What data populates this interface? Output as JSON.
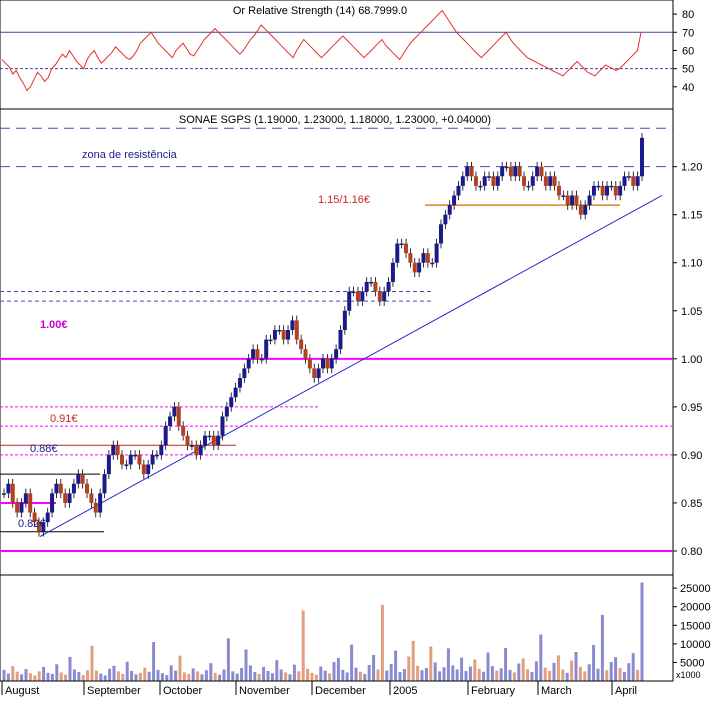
{
  "colors": {
    "background": "#ffffff",
    "frame": "#000000",
    "rsi_line": "#e8302a",
    "candle_up": "#1a1a8c",
    "candle_down": "#b3401f",
    "trendline": "#2a2ad0",
    "magenta_line": "#ff00ff",
    "resistance_dash": "#4a4ab0",
    "support_orange": "#e08020",
    "volume_up": "#8a8ad0",
    "volume_down": "#e0a080",
    "annotation_red": "#cc2020",
    "annotation_blue": "#1a1a8c",
    "annotation_magenta": "#cc00cc"
  },
  "rsi_panel": {
    "header": "Or Relative Strength (14) 68.7999.0",
    "ylim": [
      30,
      85
    ],
    "ticks": [
      "80",
      "70",
      "60",
      "50",
      "40"
    ],
    "overbought": 70,
    "midline": 50,
    "values": [
      55,
      53,
      51,
      47,
      49,
      45,
      42,
      38,
      40,
      44,
      48,
      46,
      43,
      45,
      50,
      52,
      55,
      58,
      56,
      60,
      57,
      54,
      52,
      50,
      55,
      58,
      60,
      56,
      53,
      55,
      57,
      59,
      62,
      60,
      58,
      56,
      55,
      57,
      60,
      64,
      66,
      68,
      70,
      67,
      64,
      62,
      60,
      58,
      56,
      60,
      62,
      64,
      61,
      58,
      57,
      60,
      63,
      66,
      68,
      70,
      72,
      70,
      68,
      66,
      64,
      62,
      60,
      58,
      60,
      63,
      66,
      68,
      71,
      74,
      72,
      70,
      68,
      66,
      64,
      62,
      60,
      58,
      56,
      60,
      63,
      66,
      64,
      62,
      60,
      58,
      56,
      58,
      60,
      62,
      64,
      66,
      68,
      66,
      64,
      62,
      60,
      58,
      56,
      58,
      60,
      62,
      64,
      66,
      63,
      61,
      59,
      57,
      55,
      58,
      61,
      64,
      66,
      68,
      70,
      72,
      74,
      76,
      78,
      80,
      82,
      79,
      76,
      73,
      70,
      68,
      66,
      64,
      62,
      60,
      58,
      56,
      58,
      60,
      62,
      64,
      66,
      68,
      70,
      67,
      64,
      62,
      60,
      58,
      56,
      55,
      54,
      53,
      52,
      51,
      50,
      49,
      48,
      47,
      46,
      48,
      50,
      52,
      54,
      52,
      50,
      48,
      47,
      46,
      48,
      50,
      52,
      51,
      50,
      49,
      50,
      52,
      54,
      56,
      58,
      60,
      70
    ]
  },
  "price_panel": {
    "header": "SONAE SGPS (1.19000, 1.23000, 1.18000, 1.23000, +0.04000)",
    "ylim": [
      0.775,
      1.26
    ],
    "ticks": [
      "1.20",
      "1.15",
      "1.10",
      "1.05",
      "1.00",
      "0.95",
      "0.90",
      "0.85",
      "0.80"
    ],
    "annotations": {
      "resistance_zone": "zona de resistência",
      "level_115_116": "1.15/1.16€",
      "level_100": "1.00€",
      "level_091": "0.91€",
      "level_088": "0.88€",
      "level_082": "0.82€"
    },
    "closes": [
      0.86,
      0.87,
      0.85,
      0.84,
      0.85,
      0.86,
      0.84,
      0.83,
      0.82,
      0.83,
      0.84,
      0.86,
      0.87,
      0.86,
      0.85,
      0.86,
      0.87,
      0.88,
      0.87,
      0.86,
      0.85,
      0.84,
      0.86,
      0.88,
      0.9,
      0.91,
      0.9,
      0.89,
      0.89,
      0.9,
      0.9,
      0.89,
      0.88,
      0.89,
      0.9,
      0.9,
      0.91,
      0.93,
      0.94,
      0.95,
      0.93,
      0.92,
      0.91,
      0.91,
      0.9,
      0.91,
      0.92,
      0.92,
      0.91,
      0.92,
      0.94,
      0.95,
      0.96,
      0.97,
      0.98,
      0.99,
      1.0,
      1.01,
      1.0,
      1.0,
      1.02,
      1.02,
      1.03,
      1.03,
      1.02,
      1.03,
      1.04,
      1.02,
      1.01,
      1.0,
      0.99,
      0.98,
      0.99,
      1.0,
      0.99,
      1.0,
      1.01,
      1.03,
      1.05,
      1.07,
      1.07,
      1.06,
      1.07,
      1.08,
      1.08,
      1.07,
      1.06,
      1.07,
      1.08,
      1.1,
      1.12,
      1.12,
      1.11,
      1.1,
      1.09,
      1.1,
      1.11,
      1.1,
      1.1,
      1.12,
      1.14,
      1.15,
      1.16,
      1.17,
      1.18,
      1.19,
      1.2,
      1.19,
      1.18,
      1.18,
      1.19,
      1.19,
      1.18,
      1.19,
      1.2,
      1.2,
      1.19,
      1.2,
      1.19,
      1.18,
      1.18,
      1.19,
      1.2,
      1.19,
      1.18,
      1.19,
      1.18,
      1.17,
      1.17,
      1.16,
      1.17,
      1.16,
      1.15,
      1.16,
      1.17,
      1.18,
      1.18,
      1.17,
      1.18,
      1.18,
      1.17,
      1.18,
      1.19,
      1.19,
      1.18,
      1.19,
      1.23
    ]
  },
  "volume_panel": {
    "ylim": [
      0,
      28000
    ],
    "ticks": [
      "25000",
      "20000",
      "15000",
      "10000",
      "5000"
    ],
    "unit_label": "x1000",
    "values": [
      3000,
      2000,
      4000,
      2500,
      1800,
      3200,
      2100,
      1500,
      2600,
      3800,
      2200,
      1900,
      4500,
      2300,
      1700,
      6500,
      3100,
      2400,
      1600,
      2900,
      9500,
      2800,
      2000,
      1500,
      3300,
      4100,
      2600,
      1900,
      5200,
      2700,
      1800,
      2200,
      3600,
      2500,
      10500,
      3000,
      2100,
      1600,
      4200,
      2800,
      6800,
      2300,
      1900,
      3400,
      2600,
      1800,
      2900,
      4800,
      2200,
      1700,
      3100,
      11500,
      2600,
      2000,
      3500,
      8500,
      4200,
      2400,
      1900,
      3800,
      2700,
      2100,
      5600,
      3100,
      2300,
      1800,
      4400,
      2600,
      19000,
      3300,
      2200,
      1700,
      3900,
      2800,
      2000,
      5100,
      6200,
      3000,
      2300,
      9800,
      3600,
      2500,
      1900,
      4300,
      7000,
      3100,
      20500,
      2800,
      4600,
      8200,
      2400,
      3200,
      6600,
      10800,
      4100,
      2900,
      3500,
      9300,
      5000,
      2600,
      3700,
      8800,
      4200,
      3100,
      6300,
      2700,
      3900,
      5800,
      3300,
      2500,
      7700,
      4000,
      2800,
      3400,
      8900,
      3000,
      2300,
      4700,
      6100,
      3200,
      2400,
      5300,
      12500,
      3600,
      2700,
      4900,
      6900,
      3100,
      2200,
      5500,
      7800,
      3800,
      2600,
      4500,
      9700,
      3300,
      17800,
      2900,
      5100,
      6400,
      3500,
      2400,
      4800,
      7500,
      3000,
      26500
    ]
  },
  "xaxis": {
    "months": [
      "August",
      "September",
      "October",
      "November",
      "December",
      "2005",
      "February",
      "March",
      "April"
    ]
  }
}
